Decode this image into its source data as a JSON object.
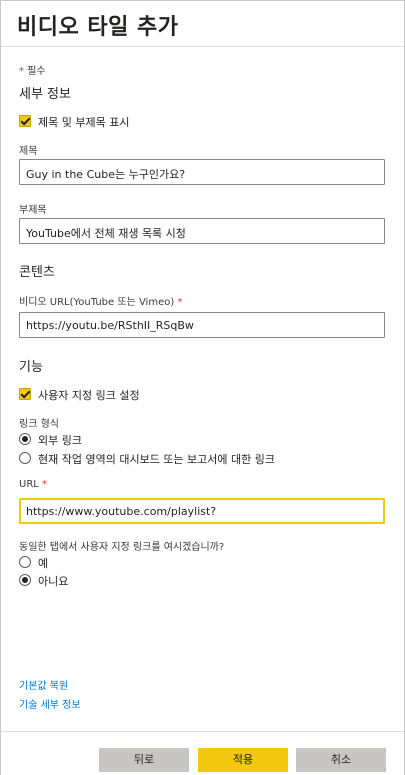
{
  "header": {
    "title": "비디오 타일 추가"
  },
  "required_note": {
    "star": "*",
    "text": "필수"
  },
  "details": {
    "heading": "세부 정보",
    "show_title_checkbox": "제목 및 부제목 표시",
    "title_label": "제목",
    "title_value": "Guy in the Cube는 누구인가요?",
    "subtitle_label": "부제목",
    "subtitle_value": "YouTube에서 전체 재생 목록 시청"
  },
  "content": {
    "heading": "콘텐츠",
    "video_url_label": "비디오 URL(YouTube 또는 Vimeo)",
    "video_url_star": "*",
    "video_url_value": "https://youtu.be/RSthII_RSqBw"
  },
  "features": {
    "heading": "기능",
    "custom_link_checkbox": "사용자 지정 링크 설정",
    "link_type_label": "링크 형식",
    "link_type_options": [
      "외부 링크",
      "현재 작업 영역의 대시보드 또는 보고서에 대한 링크"
    ],
    "link_type_selected": 0,
    "url_label": "URL",
    "url_star": "*",
    "url_value": "https://www.youtube.com/playlist?",
    "same_tab_question": "동일한 탭에서 사용자 지정 링크를 여시겠습니까?",
    "same_tab_options": [
      "예",
      "아니요"
    ],
    "same_tab_selected": 1
  },
  "links": {
    "restore_defaults": "기본값 복원",
    "tech_details": "기술 세부 정보"
  },
  "footer": {
    "back": "뒤로",
    "apply": "적용",
    "cancel": "취소"
  },
  "colors": {
    "accent": "#f2c811",
    "link": "#0078d4",
    "required": "#d13438"
  }
}
